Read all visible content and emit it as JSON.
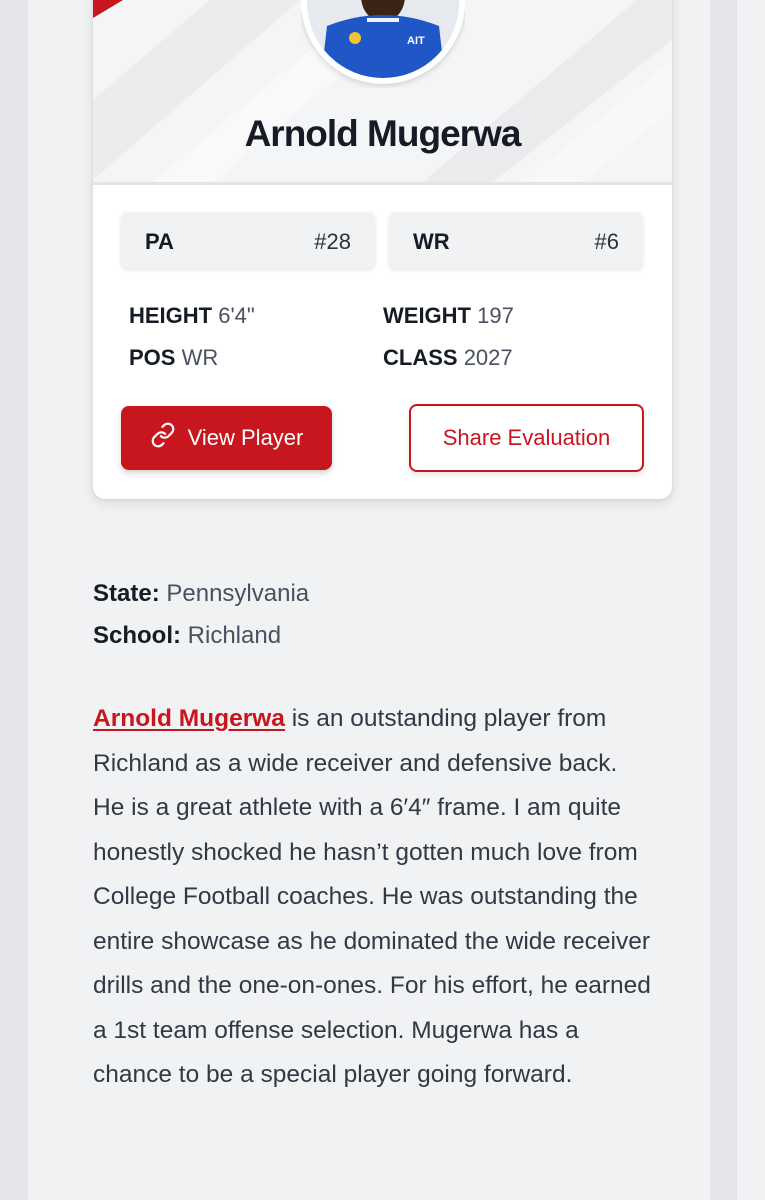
{
  "player": {
    "name": "Arnold Mugerwa",
    "state_rank": {
      "label": "PA",
      "value": "#28"
    },
    "position_rank": {
      "label": "WR",
      "value": "#6"
    },
    "stats": {
      "height": {
        "label": "HEIGHT",
        "value": "6'4\""
      },
      "weight": {
        "label": "WEIGHT",
        "value": "197"
      },
      "pos": {
        "label": "POS",
        "value": "WR"
      },
      "class": {
        "label": "CLASS",
        "value": "2027"
      }
    }
  },
  "actions": {
    "view_player": "View Player",
    "share_evaluation": "Share Evaluation"
  },
  "details": {
    "state_label": "State:",
    "state_value": "Pennsylvania",
    "school_label": "School:",
    "school_value": "Richland"
  },
  "article": {
    "link_text": "Arnold Mugerwa",
    "body": " is an outstanding player from Richland as a wide receiver and defensive back. He is a great athlete with a 6′4″ frame. I am quite honestly shocked he hasn’t gotten much love from College Football coaches. He was outstanding the entire showcase as he dominated the wide receiver drills and the one-on-ones. For his effort, he earned a 1st team offense selection. Mugerwa has a chance to be a special player going forward."
  },
  "colors": {
    "accent": "#c8161f",
    "text": "#161b26",
    "muted": "#4b5060",
    "background": "#f1f2f4"
  },
  "icons": {
    "view_player": "link-icon"
  }
}
